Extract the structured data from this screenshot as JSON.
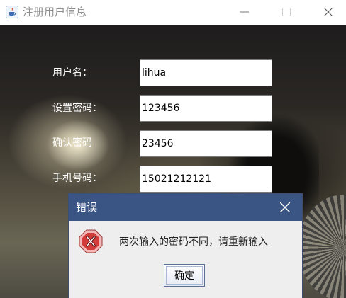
{
  "window": {
    "title": "注册用户信息",
    "icon": "java-cup-icon",
    "controls": [
      "minimize",
      "maximize",
      "close"
    ]
  },
  "form": {
    "username": {
      "label": "用户名：",
      "value": "lihua"
    },
    "password": {
      "label": "设置密码：",
      "value": "123456"
    },
    "confirm_password": {
      "label": "确认密码",
      "value": "23456"
    },
    "phone": {
      "label": "手机号码：",
      "value": "15021212121"
    }
  },
  "dialog": {
    "title": "错误",
    "icon": "error-icon",
    "message": "两次输入的密码不同，请重新输入",
    "ok_label": "确定"
  },
  "colors": {
    "dialog_titlebar": "#3a5484",
    "error_icon": "#d33a3a",
    "label_text": "#ffffff"
  }
}
